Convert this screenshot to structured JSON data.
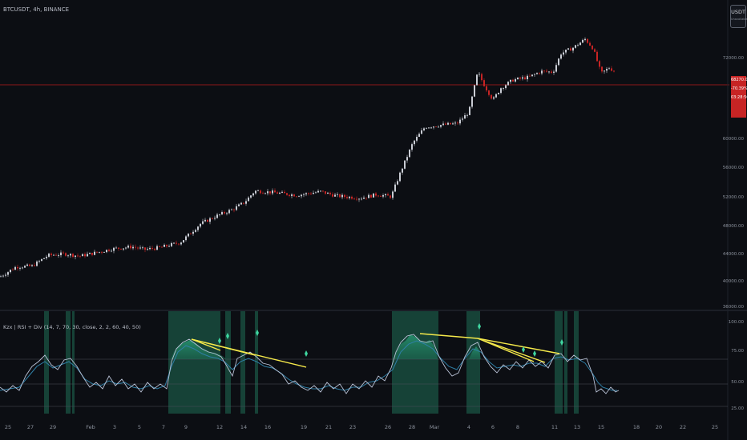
{
  "header": {
    "title": "BTCUSDT, 4h, BINANCE",
    "currency_button": "USDT",
    "currency_sub": "Unavailable"
  },
  "price_tag": {
    "price": "68270.00",
    "change": "-70.39%",
    "countdown": "03:28:56"
  },
  "price_axis": [
    "72000.00",
    "60000.00",
    "56000.00",
    "52000.00",
    "48000.00",
    "44000.00",
    "40000.00",
    "36000.00"
  ],
  "indicator": {
    "title": "Kzx | RSI + Div (14, 7, 70, 30, close, 2, 2, 60, 40, 50)",
    "axis": [
      "100.00",
      "75.00",
      "50.00",
      "25.00"
    ]
  },
  "time_axis": [
    "25",
    "27",
    "29",
    "Feb",
    "3",
    "5",
    "7",
    "9",
    "12",
    "14",
    "16",
    "19",
    "21",
    "23",
    "26",
    "28",
    "Mar",
    "4",
    "6",
    "8",
    "11",
    "13",
    "15",
    "18",
    "20",
    "22",
    "25"
  ],
  "colors": {
    "background": "#0c0e13",
    "candle_up": "#c9ccd4",
    "candle_down": "#c72424",
    "price_line": "#b71c1c",
    "rsi_fill": "#1f8a66",
    "divergence_line": "#f5e94a",
    "rsi_line": "#b9c2d6",
    "signal_line": "#2f7fa6"
  },
  "chart_data": {
    "type": "line",
    "title": "BTCUSDT, 4h, BINANCE",
    "y_range": [
      36000,
      74000
    ],
    "close_keypoints": [
      [
        0,
        39800
      ],
      [
        20,
        41200
      ],
      [
        40,
        41300
      ],
      [
        60,
        42800
      ],
      [
        80,
        43000
      ],
      [
        100,
        42700
      ],
      [
        125,
        43300
      ],
      [
        140,
        43700
      ],
      [
        165,
        44000
      ],
      [
        180,
        43600
      ],
      [
        200,
        43900
      ],
      [
        225,
        44600
      ],
      [
        250,
        47200
      ],
      [
        270,
        48300
      ],
      [
        290,
        49200
      ],
      [
        305,
        50200
      ],
      [
        318,
        51800
      ],
      [
        340,
        51600
      ],
      [
        370,
        51200
      ],
      [
        400,
        51700
      ],
      [
        420,
        51100
      ],
      [
        450,
        50800
      ],
      [
        470,
        51300
      ],
      [
        488,
        51000
      ],
      [
        500,
        54500
      ],
      [
        515,
        58500
      ],
      [
        530,
        60700
      ],
      [
        550,
        61000
      ],
      [
        570,
        61200
      ],
      [
        585,
        62800
      ],
      [
        596,
        68400
      ],
      [
        605,
        66400
      ],
      [
        615,
        64500
      ],
      [
        625,
        66200
      ],
      [
        640,
        67300
      ],
      [
        660,
        67700
      ],
      [
        675,
        68500
      ],
      [
        690,
        68400
      ],
      [
        700,
        71000
      ],
      [
        715,
        71800
      ],
      [
        730,
        73000
      ],
      [
        740,
        71700
      ],
      [
        750,
        68200
      ],
      [
        760,
        69000
      ],
      [
        768,
        68400
      ]
    ]
  }
}
